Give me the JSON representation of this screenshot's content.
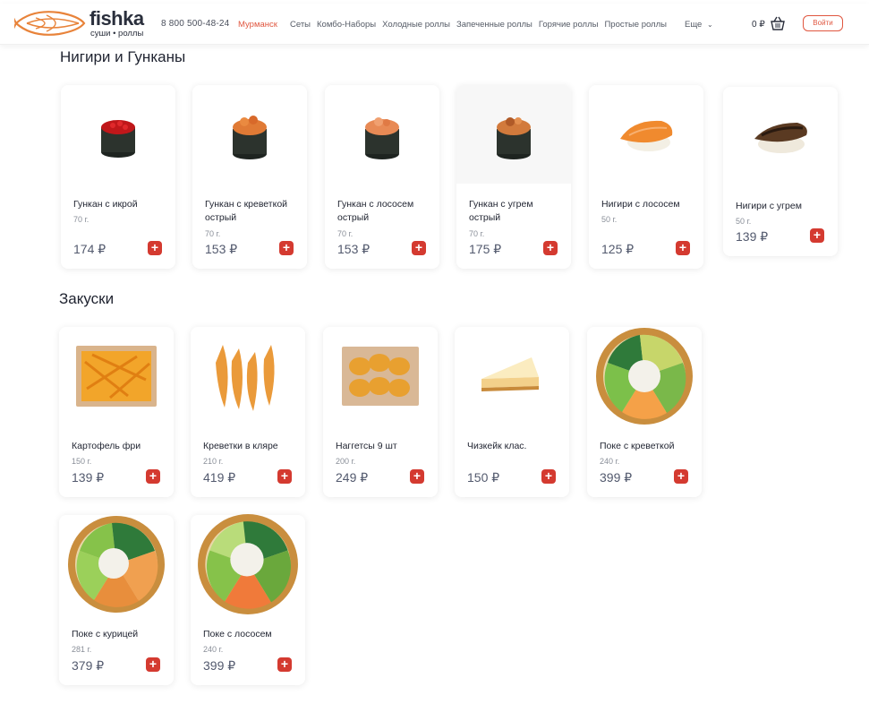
{
  "header": {
    "logo_name": "fishka",
    "logo_tagline": "суши • роллы",
    "phone": "8 800 500-48-24",
    "city": "Мурманск",
    "nav": [
      "Сеты",
      "Комбо-Наборы",
      "Холодные роллы",
      "Запеченные роллы",
      "Горячие роллы",
      "Простые роллы"
    ],
    "more": "Еще",
    "cart_sum": "0 ₽",
    "login": "Войти",
    "accent": "#e0563f"
  },
  "sections": {
    "nigiri": {
      "title": "Нигири и Гунканы",
      "items": [
        {
          "name": "Гункан с икрой",
          "weight": "70 г.",
          "price": "174 ₽"
        },
        {
          "name": "Гункан с креветкой острый",
          "weight": "70 г.",
          "price": "153 ₽"
        },
        {
          "name": "Гункан с лососем острый",
          "weight": "70 г.",
          "price": "153 ₽"
        },
        {
          "name": "Гункан с угрем острый",
          "weight": "70 г.",
          "price": "175 ₽"
        },
        {
          "name": "Нигири с лососем",
          "weight": "50 г.",
          "price": "125 ₽"
        },
        {
          "name": "Нигири с угрем",
          "weight": "50 г.",
          "price": "139 ₽"
        }
      ]
    },
    "snacks": {
      "title": "Закуски",
      "items": [
        {
          "name": "Картофель фри",
          "weight": "150 г.",
          "price": "139 ₽"
        },
        {
          "name": "Креветки в кляре",
          "weight": "210 г.",
          "price": "419 ₽"
        },
        {
          "name": "Наггетсы 9 шт",
          "weight": "200 г.",
          "price": "249 ₽"
        },
        {
          "name": "Чизкейк клас.",
          "weight": "",
          "price": "150 ₽"
        },
        {
          "name": "Поке с креветкой",
          "weight": "240 г.",
          "price": "399 ₽"
        },
        {
          "name": "Поке с курицей",
          "weight": "281 г.",
          "price": "379 ₽"
        },
        {
          "name": "Поке с лососем",
          "weight": "240 г.",
          "price": "399 ₽"
        }
      ]
    }
  },
  "add_label": "+"
}
